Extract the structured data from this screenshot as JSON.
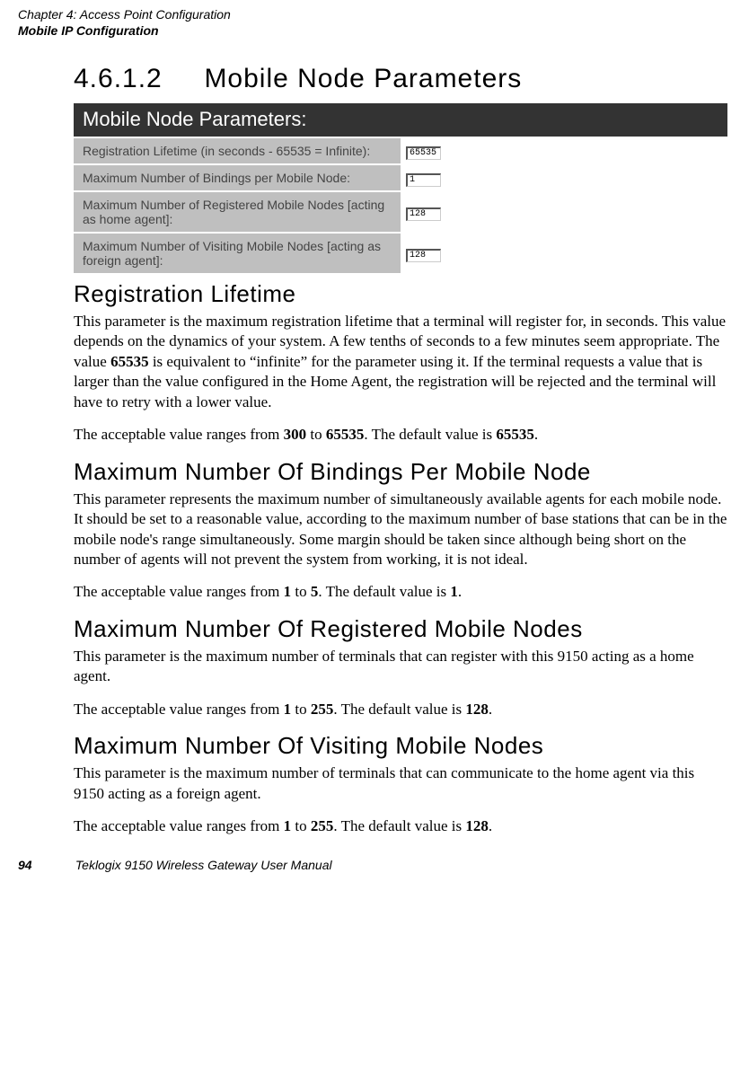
{
  "running_head": {
    "line1": "Chapter 4:  Access Point Configuration",
    "line2": "Mobile IP Configuration"
  },
  "section": {
    "number": "4.6.1.2",
    "title": "Mobile Node Parameters"
  },
  "ui": {
    "title": "Mobile Node Parameters:",
    "rows": [
      {
        "label": "Registration Lifetime (in seconds - 65535 = Infinite):",
        "value": "65535"
      },
      {
        "label": "Maximum Number of Bindings per Mobile Node:",
        "value": "1"
      },
      {
        "label": "Maximum Number of Registered Mobile Nodes [acting as home agent]:",
        "value": "128"
      },
      {
        "label": "Maximum Number of Visiting Mobile Nodes [acting as foreign agent]:",
        "value": "128"
      }
    ]
  },
  "sections": {
    "reg": {
      "title": "Registration Lifetime",
      "p1a": "This parameter is the maximum registration lifetime that a terminal will register for, in seconds. This value depends on the dynamics of your system. A few tenths of seconds to a few minutes seem appropriate. The value ",
      "p1b": "65535",
      "p1c": " is equivalent to “infinite” for the parameter using it. If the terminal requests a value that is larger than the value configured in the Home Agent, the registration will be rejected and the terminal will have to retry with a lower value.",
      "p2a": "The acceptable value ranges from ",
      "p2b": "300",
      "p2c": " to ",
      "p2d": "65535",
      "p2e": ". The default value is ",
      "p2f": "65535",
      "p2g": "."
    },
    "bind": {
      "title": "Maximum Number Of Bindings Per Mobile Node",
      "p1": "This parameter represents the maximum number of simultaneously available agents for each mobile node. It should be set to a reasonable value, according to the maximum number of base stations that can be in the mobile node's range simultaneously. Some margin should be taken since although being short on the number of agents will not prevent the system from working, it is not ideal.",
      "p2a": "The acceptable value ranges from ",
      "p2b": "1",
      "p2c": " to ",
      "p2d": "5",
      "p2e": ". The default value is ",
      "p2f": "1",
      "p2g": "."
    },
    "regnodes": {
      "title": "Maximum Number Of Registered Mobile Nodes",
      "p1": "This parameter is the maximum number of terminals that can register with this 9150 acting as a home agent.",
      "p2a": "The acceptable value ranges from ",
      "p2b": "1",
      "p2c": " to ",
      "p2d": "255",
      "p2e": ". The default value is ",
      "p2f": "128",
      "p2g": "."
    },
    "visit": {
      "title": "Maximum Number Of Visiting Mobile Nodes",
      "p1": "This parameter is the maximum number of terminals that can communicate to the home agent via this 9150 acting as a foreign agent.",
      "p2a": "The acceptable value ranges from ",
      "p2b": "1",
      "p2c": " to ",
      "p2d": "255",
      "p2e": ". The default value is ",
      "p2f": "128",
      "p2g": "."
    }
  },
  "footer": {
    "page": "94",
    "title": "Teklogix 9150 Wireless Gateway User Manual"
  }
}
